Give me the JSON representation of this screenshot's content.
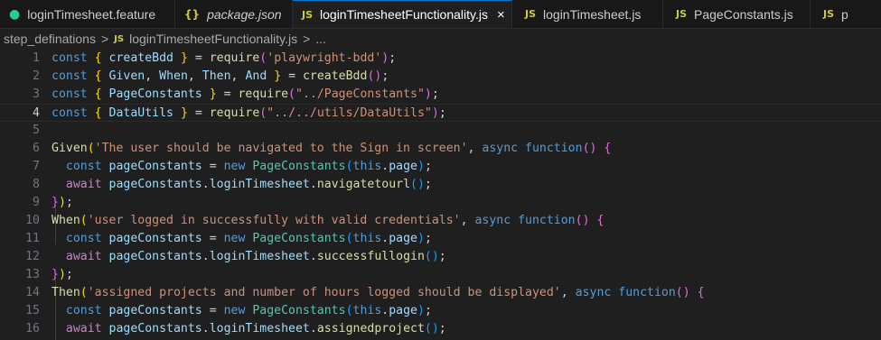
{
  "tabs": [
    {
      "icon": "cucumber-icon",
      "label": "loginTimesheet.feature",
      "italic": false,
      "active": false
    },
    {
      "icon": "json-icon",
      "label": "package.json",
      "italic": true,
      "active": false
    },
    {
      "icon": "js-icon",
      "label": "loginTimesheetFunctionality.js",
      "italic": false,
      "active": true
    },
    {
      "icon": "js-icon",
      "label": "loginTimesheet.js",
      "italic": false,
      "active": false
    },
    {
      "icon": "js-icon",
      "label": "PageConstants.js",
      "italic": false,
      "active": false
    },
    {
      "icon": "js-icon",
      "label": "p",
      "italic": false,
      "active": false
    }
  ],
  "icon_text": {
    "js": "JS",
    "json": "{}",
    "cucumber": "●",
    "close": "×"
  },
  "breadcrumb": {
    "folder": "step_definations",
    "separator": ">",
    "file": "loginTimesheetFunctionality.js",
    "trailing": "..."
  },
  "editor": {
    "current_line": 4,
    "lines": [
      {
        "n": "1",
        "t": [
          [
            "kw",
            "const "
          ],
          [
            "b1",
            "{ "
          ],
          [
            "var",
            "createBdd"
          ],
          [
            "b1",
            " }"
          ],
          [
            "p",
            " = "
          ],
          [
            "fn",
            "require"
          ],
          [
            "b2",
            "("
          ],
          [
            "str",
            "'playwright-bdd'"
          ],
          [
            "b2",
            ")"
          ],
          [
            "p",
            ";"
          ]
        ]
      },
      {
        "n": "2",
        "t": [
          [
            "kw",
            "const "
          ],
          [
            "b1",
            "{ "
          ],
          [
            "var",
            "Given"
          ],
          [
            "p",
            ", "
          ],
          [
            "var",
            "When"
          ],
          [
            "p",
            ", "
          ],
          [
            "var",
            "Then"
          ],
          [
            "p",
            ", "
          ],
          [
            "var",
            "And"
          ],
          [
            "b1",
            " }"
          ],
          [
            "p",
            " = "
          ],
          [
            "fn",
            "createBdd"
          ],
          [
            "b2",
            "()"
          ],
          [
            "p",
            ";"
          ]
        ]
      },
      {
        "n": "3",
        "t": [
          [
            "kw",
            "const "
          ],
          [
            "b1",
            "{ "
          ],
          [
            "var",
            "PageConstants"
          ],
          [
            "b1",
            " }"
          ],
          [
            "p",
            " = "
          ],
          [
            "fn",
            "require"
          ],
          [
            "b2",
            "("
          ],
          [
            "str",
            "\"../PageConstants\""
          ],
          [
            "b2",
            ")"
          ],
          [
            "p",
            ";"
          ]
        ]
      },
      {
        "n": "4",
        "t": [
          [
            "kw",
            "const "
          ],
          [
            "b1",
            "{ "
          ],
          [
            "var",
            "DataUtils"
          ],
          [
            "b1",
            " }"
          ],
          [
            "p",
            " = "
          ],
          [
            "fn",
            "require"
          ],
          [
            "b2",
            "("
          ],
          [
            "str",
            "\"../../utils/DataUtils\""
          ],
          [
            "b2",
            ")"
          ],
          [
            "p",
            ";"
          ]
        ]
      },
      {
        "n": "5",
        "t": []
      },
      {
        "n": "6",
        "t": [
          [
            "fn",
            "Given"
          ],
          [
            "b1",
            "("
          ],
          [
            "str",
            "'The user should be navigated to the Sign in screen'"
          ],
          [
            "p",
            ", "
          ],
          [
            "kw",
            "async "
          ],
          [
            "kw",
            "function"
          ],
          [
            "b2",
            "() "
          ],
          [
            "b2",
            "{"
          ]
        ]
      },
      {
        "n": "7",
        "t": [
          [
            "p",
            "  "
          ],
          [
            "kw",
            "const "
          ],
          [
            "var",
            "pageConstants"
          ],
          [
            "p",
            " = "
          ],
          [
            "kw",
            "new "
          ],
          [
            "cls",
            "PageConstants"
          ],
          [
            "b3",
            "("
          ],
          [
            "kw",
            "this"
          ],
          [
            "p",
            "."
          ],
          [
            "var",
            "page"
          ],
          [
            "b3",
            ")"
          ],
          [
            "p",
            ";"
          ]
        ]
      },
      {
        "n": "8",
        "t": [
          [
            "p",
            "  "
          ],
          [
            "ctl",
            "await "
          ],
          [
            "var",
            "pageConstants"
          ],
          [
            "p",
            "."
          ],
          [
            "var",
            "loginTimesheet"
          ],
          [
            "p",
            "."
          ],
          [
            "fn",
            "navigatetourl"
          ],
          [
            "b3",
            "()"
          ],
          [
            "p",
            ";"
          ]
        ]
      },
      {
        "n": "9",
        "t": [
          [
            "b2",
            "}"
          ],
          [
            "b1",
            ")"
          ],
          [
            "p",
            ";"
          ]
        ]
      },
      {
        "n": "10",
        "t": [
          [
            "fn",
            "When"
          ],
          [
            "b1",
            "("
          ],
          [
            "str",
            "'user logged in successfully with valid credentials'"
          ],
          [
            "p",
            ", "
          ],
          [
            "kw",
            "async "
          ],
          [
            "kw",
            "function"
          ],
          [
            "b2",
            "() "
          ],
          [
            "b2",
            "{"
          ]
        ]
      },
      {
        "n": "11",
        "t": [
          [
            "p",
            "  "
          ],
          [
            "kw",
            "const "
          ],
          [
            "var",
            "pageConstants"
          ],
          [
            "p",
            " = "
          ],
          [
            "kw",
            "new "
          ],
          [
            "cls",
            "PageConstants"
          ],
          [
            "b3",
            "("
          ],
          [
            "kw",
            "this"
          ],
          [
            "p",
            "."
          ],
          [
            "var",
            "page"
          ],
          [
            "b3",
            ")"
          ],
          [
            "p",
            ";"
          ]
        ]
      },
      {
        "n": "12",
        "t": [
          [
            "p",
            "  "
          ],
          [
            "ctl",
            "await "
          ],
          [
            "var",
            "pageConstants"
          ],
          [
            "p",
            "."
          ],
          [
            "var",
            "loginTimesheet"
          ],
          [
            "p",
            "."
          ],
          [
            "fn",
            "successfullogin"
          ],
          [
            "b3",
            "()"
          ],
          [
            "p",
            ";"
          ]
        ]
      },
      {
        "n": "13",
        "t": [
          [
            "b2",
            "}"
          ],
          [
            "b1",
            ")"
          ],
          [
            "p",
            ";"
          ]
        ]
      },
      {
        "n": "14",
        "t": [
          [
            "fn",
            "Then"
          ],
          [
            "b1",
            "("
          ],
          [
            "str",
            "'assigned projects and number of hours logged should be displayed'"
          ],
          [
            "p",
            ", "
          ],
          [
            "kw",
            "async "
          ],
          [
            "kw",
            "function"
          ],
          [
            "b2",
            "() "
          ],
          [
            "b2",
            "{"
          ]
        ]
      },
      {
        "n": "15",
        "t": [
          [
            "p",
            "  "
          ],
          [
            "kw",
            "const "
          ],
          [
            "var",
            "pageConstants"
          ],
          [
            "p",
            " = "
          ],
          [
            "kw",
            "new "
          ],
          [
            "cls",
            "PageConstants"
          ],
          [
            "b3",
            "("
          ],
          [
            "kw",
            "this"
          ],
          [
            "p",
            "."
          ],
          [
            "var",
            "page"
          ],
          [
            "b3",
            ")"
          ],
          [
            "p",
            ";"
          ]
        ]
      },
      {
        "n": "16",
        "t": [
          [
            "p",
            "  "
          ],
          [
            "ctl",
            "await "
          ],
          [
            "var",
            "pageConstants"
          ],
          [
            "p",
            "."
          ],
          [
            "var",
            "loginTimesheet"
          ],
          [
            "p",
            "."
          ],
          [
            "fn",
            "assignedproject"
          ],
          [
            "b3",
            "()"
          ],
          [
            "p",
            ";"
          ]
        ]
      }
    ]
  }
}
